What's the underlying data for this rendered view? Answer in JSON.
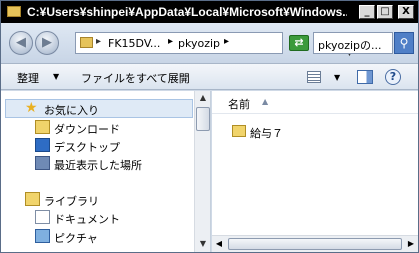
{
  "window": {
    "title": "C:¥Users¥shinpei¥AppData¥Local¥Microsoft¥Windows...",
    "minimize_glyph": "_",
    "maximize_glyph": "□",
    "close_glyph": "X"
  },
  "address": {
    "back_glyph": "◀",
    "forward_glyph": "▶",
    "separator": "▸",
    "segments": [
      "FK15DV...",
      "pkyozip"
    ],
    "refresh_glyph": "⇄",
    "search_placeholder": "pkyozipの...",
    "search_glyph": "⚲"
  },
  "toolbar": {
    "organize_label": "整理",
    "dropdown_glyph": "▼",
    "extract_all_label": "ファイルをすべて展開",
    "help_glyph": "?"
  },
  "nav": {
    "star_glyph": "★",
    "items": [
      {
        "label": "お気に入り",
        "icon": "star-icon"
      },
      {
        "label": "ダウンロード",
        "icon": "downloads-icon"
      },
      {
        "label": "デスクトップ",
        "icon": "desktop-icon"
      },
      {
        "label": "最近表示した場所",
        "icon": "recent-places-icon"
      },
      {
        "label": "ライブラリ",
        "icon": "libraries-icon"
      },
      {
        "label": "ドキュメント",
        "icon": "documents-icon"
      },
      {
        "label": "ピクチャ",
        "icon": "pictures-icon"
      }
    ]
  },
  "scrollbar": {
    "up_glyph": "▲",
    "down_glyph": "▼",
    "left_glyph": "◀",
    "right_glyph": "▶"
  },
  "content": {
    "column_header": "名前",
    "sort_glyph": "▲",
    "files": [
      {
        "name": "給与７",
        "icon": "folder-icon"
      }
    ]
  }
}
